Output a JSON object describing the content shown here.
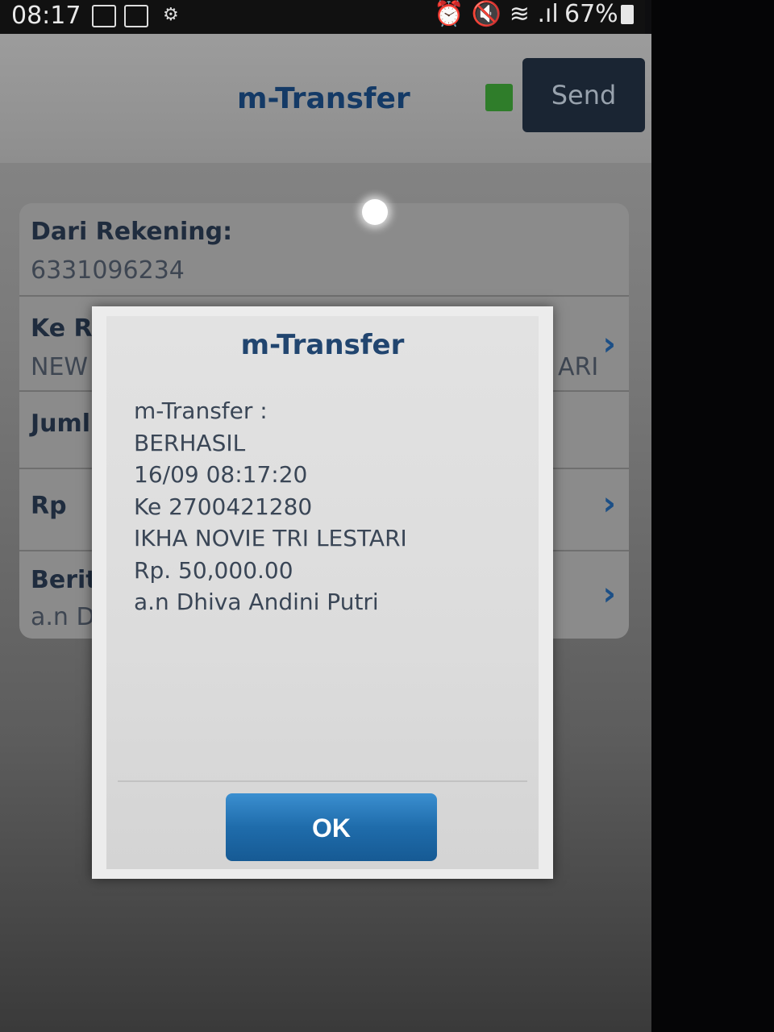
{
  "status_bar": {
    "time": "08:17",
    "battery": "67%"
  },
  "header": {
    "title": "m-Transfer",
    "send_label": "Send"
  },
  "form": {
    "from_account_label": "Dari Rekening:",
    "from_account_value": "6331096234",
    "to_account_label_partial": "Ke R",
    "to_account_value_partial": "NEW",
    "to_account_value_right": "ARI",
    "amount_label_partial": "Juml",
    "currency_label": "Rp",
    "note_label_partial": "Berit",
    "note_value_partial": "a.n D"
  },
  "dialog": {
    "title": "m-Transfer",
    "lines": [
      "m-Transfer :",
      "BERHASIL",
      "16/09 08:17:20",
      "Ke 2700421280",
      "IKHA NOVIE TRI LESTARI",
      "Rp. 50,000.00",
      "a.n Dhiva Andini Putri"
    ],
    "ok_label": "OK"
  },
  "colors": {
    "title_blue": "#21456f",
    "ok_button": "#1f6cab",
    "indicator_green": "#2f7d2a"
  }
}
